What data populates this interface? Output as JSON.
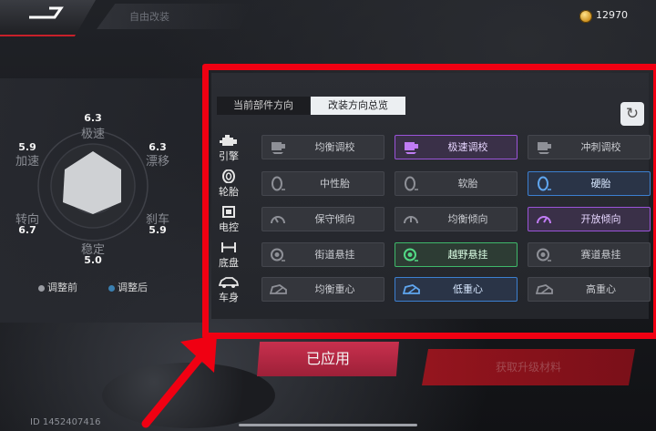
{
  "header": {
    "back_icon": "back-arrow-icon",
    "ghost_tab": "自由改装",
    "coins": "12970"
  },
  "stats": {
    "top": {
      "label": "极速",
      "value": "6.3"
    },
    "upper_left": {
      "label": "加速",
      "value": "5.9"
    },
    "upper_right": {
      "label": "漂移",
      "value": "6.3"
    },
    "lower_left": {
      "label": "转向",
      "value": "6.7"
    },
    "lower_right": {
      "label": "刹车",
      "value": "5.9"
    },
    "bottom": {
      "label": "稳定",
      "value": "5.0"
    },
    "legend_before": "调整前",
    "legend_after": "调整后"
  },
  "tabs": {
    "current": "当前部件方向",
    "overview": "改装方向总览"
  },
  "rows": [
    {
      "category": "引擎",
      "icon": "engine-icon",
      "options": [
        "均衡调校",
        "极速调校",
        "冲刺调校"
      ],
      "selected": 1
    },
    {
      "category": "轮胎",
      "icon": "tire-icon",
      "options": [
        "中性胎",
        "软胎",
        "硬胎"
      ],
      "selected": 2
    },
    {
      "category": "电控",
      "icon": "chip-icon",
      "options": [
        "保守倾向",
        "均衡倾向",
        "开放倾向"
      ],
      "selected": 2
    },
    {
      "category": "底盘",
      "icon": "chassis-icon",
      "options": [
        "街道悬挂",
        "越野悬挂",
        "赛道悬挂"
      ],
      "selected": 1
    },
    {
      "category": "车身",
      "icon": "car-body-icon",
      "options": [
        "均衡重心",
        "低重心",
        "高重心"
      ],
      "selected": 1
    }
  ],
  "buttons": {
    "applied": "已应用",
    "get_material": "获取升级材料"
  },
  "footer": {
    "id_text": "ID 1452407416"
  },
  "colors": {
    "highlight": "#f00012",
    "purple": "#9b54d9",
    "blue": "#3c7fd0",
    "green": "#3fb86a"
  }
}
